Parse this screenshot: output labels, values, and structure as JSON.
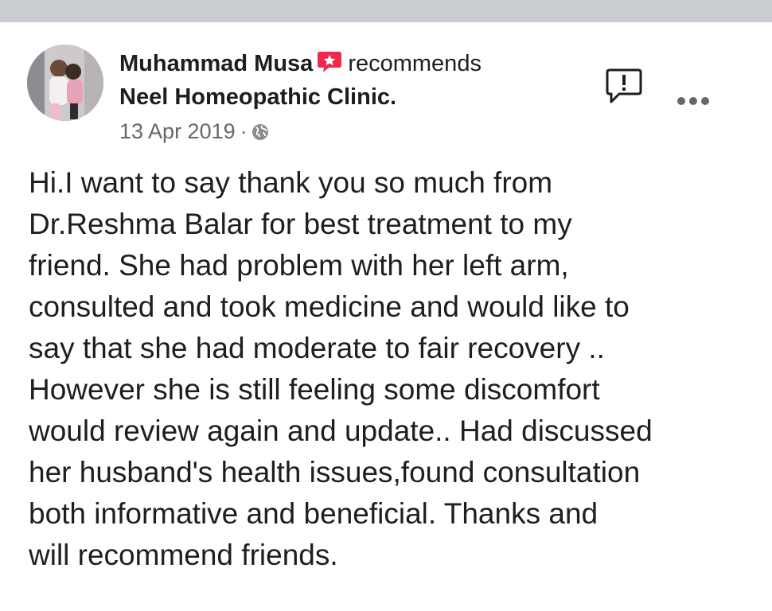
{
  "post": {
    "author": "Muhammad Musa",
    "action": "recommends",
    "page": "Neel Homeopathic Clinic.",
    "date": "13 Apr 2019",
    "separator": "·",
    "privacy_icon": "globe-icon",
    "badge_icon": "recommend-badge-icon",
    "report_icon": "report-icon",
    "menu_icon": "more-options-icon",
    "body": "Hi.I want to say thank you so much from\nDr.Reshma Balar for best treatment to my\nfriend. She had problem with her left arm,\nconsulted and took medicine and would like to\nsay that  she had moderate to fair recovery ..\nHowever she is still feeling some discomfort\nwould review again and update.. Had discussed\nher husband's health issues,found consultation\nboth informative and beneficial.  Thanks and\nwill recommend friends."
  },
  "colors": {
    "top_bar": "#c9ccd1",
    "badge": "#f02849",
    "secondary_text": "#65676b",
    "primary_text": "#1c1e21"
  }
}
